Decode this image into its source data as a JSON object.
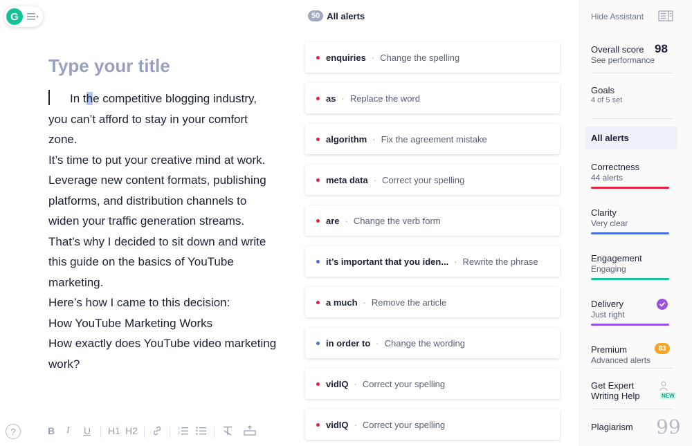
{
  "editor": {
    "title_placeholder": "Type your title",
    "paragraphs": [
      "competitive blogging industry, you can’t afford to stay in your comfort zone.",
      "It’s time to put your creative mind at work.",
      "Leverage new content formats, publishing platforms, and distribution channels to widen your traffic generation streams.",
      "That’s why I decided to sit down and write this guide on the basics of YouTube marketing.",
      "Here’s how I came to this decision:",
      "How YouTube Marketing Works",
      "How exactly does YouTube video marketing work?"
    ],
    "first_line_prefix": "In t",
    "first_line_highlight": "h",
    "first_line_rest": "e ",
    "help_label": "?",
    "toolbar": {
      "bold": "B",
      "italic": "I",
      "underline": "U",
      "h1": "H1",
      "h2": "H2"
    }
  },
  "alerts": {
    "count": "50",
    "title": "All alerts",
    "items": [
      {
        "word": "enquiries",
        "desc": "Change the spelling",
        "color": "#e2213c"
      },
      {
        "word": "as",
        "desc": "Replace the word",
        "color": "#e2213c"
      },
      {
        "word": "algorithm",
        "desc": "Fix the agreement mistake",
        "color": "#e2213c"
      },
      {
        "word": "meta data",
        "desc": "Correct your spelling",
        "color": "#e2213c"
      },
      {
        "word": "are",
        "desc": "Change the verb form",
        "color": "#e2213c"
      },
      {
        "word": "it’s important that you iden...",
        "desc": "Rewrite the phrase",
        "color": "#4a6ee0"
      },
      {
        "word": "a much",
        "desc": "Remove the article",
        "color": "#e2213c"
      },
      {
        "word": "in order to",
        "desc": "Change the wording",
        "color": "#4a6ee0"
      },
      {
        "word": "vidIQ",
        "desc": "Correct your spelling",
        "color": "#e2213c"
      },
      {
        "word": "vidIQ",
        "desc": "Correct your spelling",
        "color": "#e2213c"
      }
    ],
    "separator": "·"
  },
  "sidebar": {
    "hide_assistant": "Hide Assistant",
    "overall_score_label": "Overall score",
    "overall_score": "98",
    "see_performance": "See performance",
    "goals_label": "Goals",
    "goals_sub": "4 of 5 set",
    "all_alerts": "All alerts",
    "categories": [
      {
        "title": "Correctness",
        "sub": "44 alerts",
        "color": "#e2213c"
      },
      {
        "title": "Clarity",
        "sub": "Very clear",
        "color": "#4a6ee0"
      },
      {
        "title": "Engagement",
        "sub": "Engaging",
        "color": "#15c39a"
      },
      {
        "title": "Delivery",
        "sub": "Just right",
        "color": "#9b51e0"
      }
    ],
    "premium_label": "Premium",
    "premium_sub": "Advanced alerts",
    "premium_count": "83",
    "expert_line1": "Get Expert",
    "expert_line2": "Writing Help",
    "new_badge": "NEW",
    "plagiarism": "Plagiarism",
    "quote_glyph": "99"
  }
}
